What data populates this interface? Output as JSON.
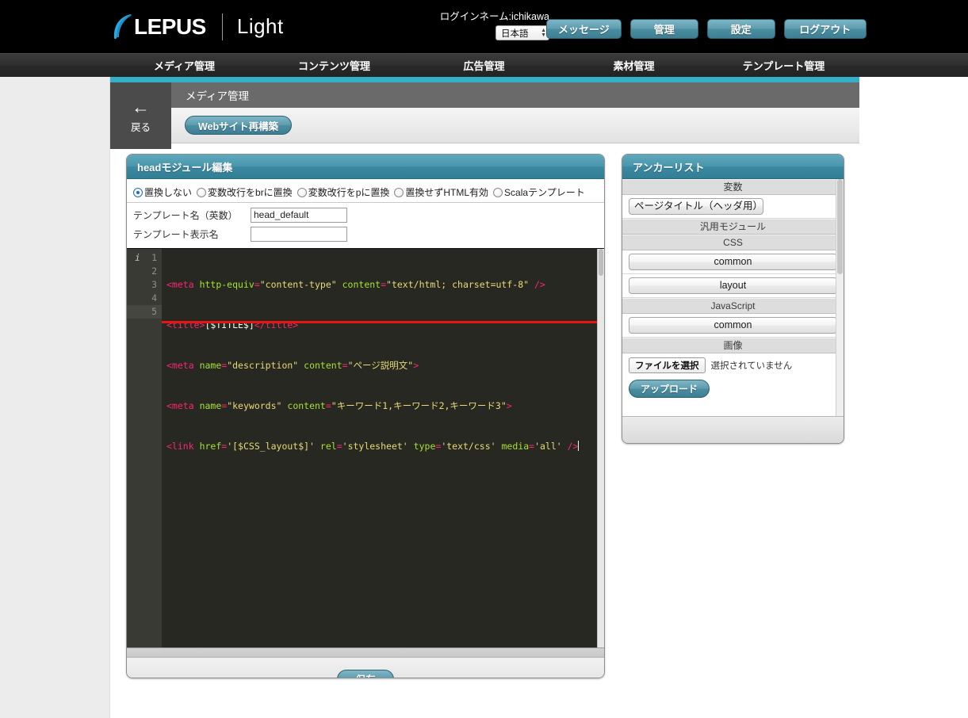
{
  "header": {
    "brand": "LEPUS",
    "edition": "Light",
    "login_label": "ログインネーム:ichikawa",
    "language_value": "日本語",
    "buttons": [
      {
        "label": "メッセージ",
        "name": "message-button"
      },
      {
        "label": "管理",
        "name": "admin-button"
      },
      {
        "label": "設定",
        "name": "settings-button"
      },
      {
        "label": "ログアウト",
        "name": "logout-button"
      }
    ]
  },
  "nav": {
    "items": [
      {
        "label": "メディア管理",
        "name": "nav-media"
      },
      {
        "label": "コンテンツ管理",
        "name": "nav-contents"
      },
      {
        "label": "広告管理",
        "name": "nav-ads"
      },
      {
        "label": "素材管理",
        "name": "nav-materials"
      },
      {
        "label": "テンプレート管理",
        "name": "nav-templates"
      }
    ]
  },
  "subheader": {
    "back_label": "戻る",
    "back_arrow": "←",
    "page_title": "メディア管理",
    "rebuild_label": "Webサイト再構築"
  },
  "editor": {
    "panel_title": "headモジュール編集",
    "radios": [
      {
        "label": "置換しない",
        "selected": true
      },
      {
        "label": "変数改行をbrに置換",
        "selected": false
      },
      {
        "label": "変数改行をpに置換",
        "selected": false
      },
      {
        "label": "置換せずHTML有効",
        "selected": false
      },
      {
        "label": "Scalaテンプレート",
        "selected": false
      }
    ],
    "fields": [
      {
        "label": "テンプレート名（英数）",
        "value": "head_default",
        "placeholder": ""
      },
      {
        "label": "テンプレート表示名",
        "value": "",
        "placeholder": ""
      }
    ],
    "code_lines": [
      "1",
      "2",
      "3",
      "4",
      "5"
    ],
    "code": {
      "l1": "<meta http-equiv=\"content-type\" content=\"text/html; charset=utf-8\" />",
      "l2": "<title>[$TITLE$]</title>",
      "l3": "<meta name=\"description\" content=\"ページ説明文\">",
      "l4": "<meta name=\"keywords\" content=\"キーワード1,キーワード2,キーワード3\">",
      "l5": "<link href='[$CSS_layout$]' rel='stylesheet' type='text/css' media='all' />"
    },
    "save_label": "保存"
  },
  "anchor": {
    "panel_title": "アンカーリスト",
    "sections": [
      {
        "title": "変数",
        "items": [
          {
            "label": "ページタイトル（ヘッダ用）"
          }
        ]
      },
      {
        "title": "汎用モジュール",
        "items": []
      },
      {
        "title": "CSS",
        "items": [
          {
            "label": "common"
          },
          {
            "label": "layout"
          }
        ]
      },
      {
        "title": "JavaScript",
        "items": [
          {
            "label": "common"
          }
        ]
      },
      {
        "title": "画像",
        "items": []
      }
    ],
    "file_choose_label": "ファイルを選択",
    "file_none_label": "選択されていません",
    "upload_label": "アップロード"
  },
  "colors": {
    "accent_teal": "#4a8ea2",
    "strip_teal": "#35aec8",
    "editor_bg": "#272822",
    "tag_pink": "#f92672",
    "attr_green": "#a6e22e",
    "value_yellow": "#e6db74",
    "error_red": "#e81313"
  }
}
